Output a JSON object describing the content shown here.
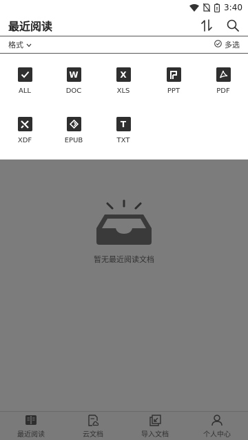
{
  "status": {
    "time": "3:40",
    "icons": [
      "wifi-icon",
      "no-sim-icon",
      "battery-icon"
    ]
  },
  "header": {
    "title": "最近阅读",
    "actions": [
      "sort-icon",
      "search-icon"
    ]
  },
  "filter": {
    "format_label": "格式",
    "multiselect_label": "多选"
  },
  "formats": [
    {
      "label": "ALL",
      "icon": "check"
    },
    {
      "label": "DOC",
      "icon": "W"
    },
    {
      "label": "XLS",
      "icon": "X"
    },
    {
      "label": "PPT",
      "icon": "P"
    },
    {
      "label": "PDF",
      "icon": "pdf"
    },
    {
      "label": "XDF",
      "icon": "xdf"
    },
    {
      "label": "EPUB",
      "icon": "epub"
    },
    {
      "label": "TXT",
      "icon": "T"
    }
  ],
  "empty": {
    "message": "暂无最近阅读文档"
  },
  "bottom_nav": [
    {
      "label": "最近阅读",
      "icon": "book-icon"
    },
    {
      "label": "云文档",
      "icon": "cloud-doc-icon"
    },
    {
      "label": "导入文档",
      "icon": "import-icon"
    },
    {
      "label": "个人中心",
      "icon": "person-icon"
    }
  ]
}
